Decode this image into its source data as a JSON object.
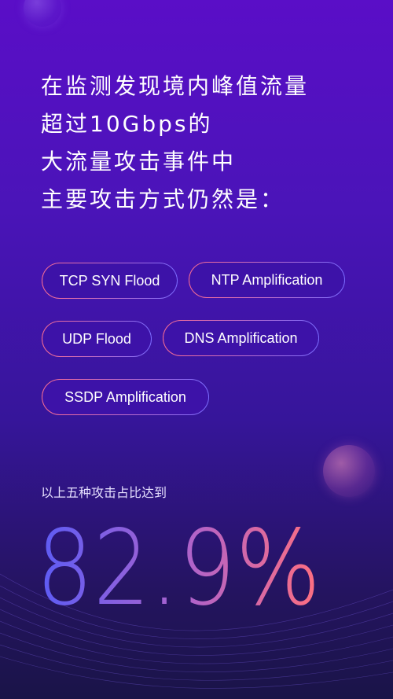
{
  "headline": {
    "lines": [
      "在监测发现境内峰值流量",
      "超过10Gbps的",
      "大流量攻击事件中",
      "主要攻击方式仍然是："
    ]
  },
  "tags": [
    "TCP SYN Flood",
    "NTP Amplification",
    "UDP Flood",
    "DNS Amplification",
    "SSDP Amplification"
  ],
  "stat": {
    "caption": "以上五种攻击占比达到",
    "value": "82.9%"
  },
  "colors": {
    "background_top": "#5a0ec7",
    "background_bottom": "#1a1448",
    "gradient_start": "#5b5cf6",
    "gradient_end": "#ff6f7f",
    "tag_border_start": "#ff6f91",
    "tag_border_end": "#7b6cff"
  }
}
